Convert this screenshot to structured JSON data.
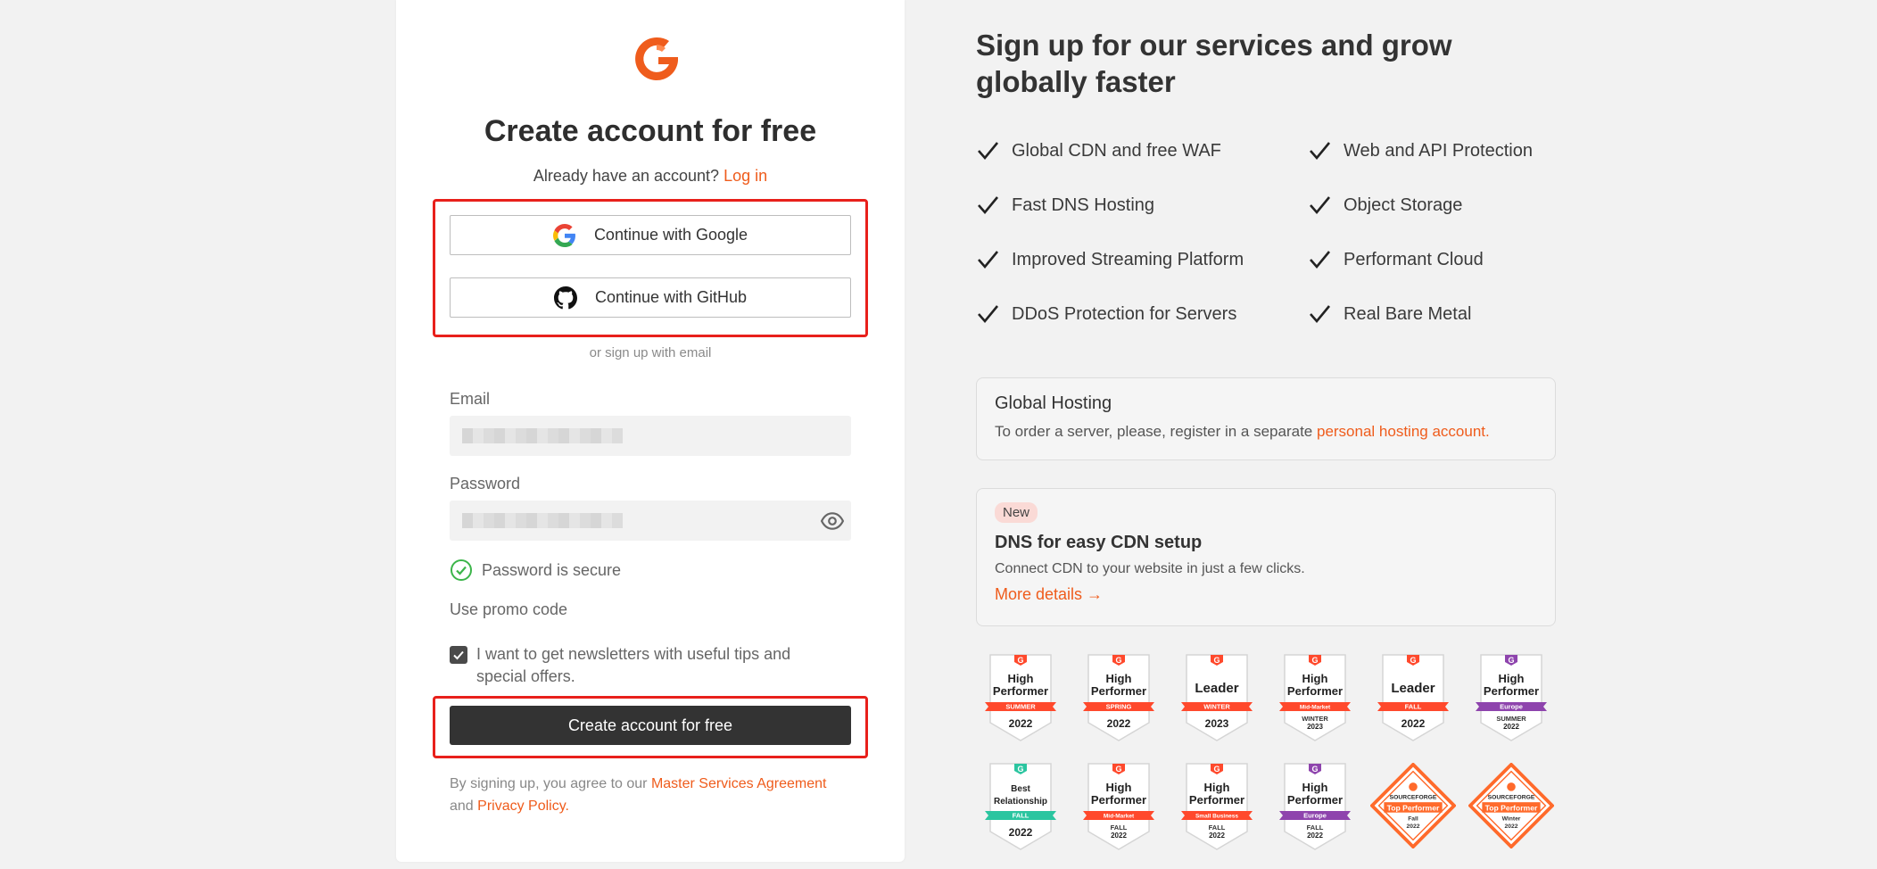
{
  "signup": {
    "title": "Create account for free",
    "have_account_text": "Already have an account?",
    "login_link": "Log in",
    "google_button": "Continue with Google",
    "github_button": "Continue with GitHub",
    "or_email": "or sign up with email",
    "email_label": "Email",
    "password_label": "Password",
    "password_status": "Password is secure",
    "promo_code": "Use promo code",
    "newsletter_label": "I want to get newsletters with useful tips and special offers.",
    "newsletter_checked": true,
    "create_button": "Create account for free",
    "terms_prefix": "By signing up, you agree to our",
    "terms_link": "Master Services Agreement",
    "terms_and": "and",
    "privacy_link": "Privacy Policy."
  },
  "promo": {
    "title": "Sign up for our services and grow globally faster",
    "features_left": [
      "Global CDN and free WAF",
      "Fast DNS Hosting",
      "Improved Streaming Platform",
      "DDoS Protection for Servers"
    ],
    "features_right": [
      "Web and API Protection",
      "Object Storage",
      "Performant Cloud",
      "Real Bare Metal"
    ],
    "hosting": {
      "title": "Global Hosting",
      "text": "To order a server, please, register in a separate",
      "link": "personal hosting account."
    },
    "dns": {
      "tag": "New",
      "title": "DNS for easy CDN setup",
      "text": "Connect CDN to your website in just a few clicks.",
      "link": "More details →"
    },
    "badges_row1": [
      {
        "line1": "High",
        "line2": "Performer",
        "ribbon": "SUMMER",
        "season": "",
        "year": "2022",
        "color": "#ff492c"
      },
      {
        "line1": "High",
        "line2": "Performer",
        "ribbon": "SPRING",
        "season": "",
        "year": "2022",
        "color": "#ff492c"
      },
      {
        "line1": "Leader",
        "line2": "",
        "ribbon": "WINTER",
        "season": "",
        "year": "2023",
        "color": "#ff492c"
      },
      {
        "line1": "High",
        "line2": "Performer",
        "ribbon": "Mid-Market",
        "season": "WINTER",
        "year": "2023",
        "color": "#ff492c"
      },
      {
        "line1": "Leader",
        "line2": "",
        "ribbon": "FALL",
        "season": "",
        "year": "2022",
        "color": "#ff492c"
      },
      {
        "line1": "High",
        "line2": "Performer",
        "ribbon": "Europe",
        "season": "SUMMER",
        "year": "2022",
        "color": "#8e44ad"
      }
    ],
    "badges_row2": [
      {
        "line1": "Best",
        "line2": "Relationship",
        "ribbon": "FALL",
        "season": "",
        "year": "2022",
        "color": "#2bc5a0"
      },
      {
        "line1": "High",
        "line2": "Performer",
        "ribbon": "Mid-Market",
        "season": "FALL",
        "year": "2022",
        "color": "#ff492c"
      },
      {
        "line1": "High",
        "line2": "Performer",
        "ribbon": "Small Business",
        "season": "FALL",
        "year": "2022",
        "color": "#ff492c"
      },
      {
        "line1": "High",
        "line2": "Performer",
        "ribbon": "Europe",
        "season": "FALL",
        "year": "2022",
        "color": "#8e44ad"
      }
    ],
    "sourceforge_badges": [
      {
        "brand": "SOURCEFORGE",
        "label": "Top Performer",
        "season": "Fall",
        "year": "2022"
      },
      {
        "brand": "SOURCEFORGE",
        "label": "Top Performer",
        "season": "Winter",
        "year": "2022"
      }
    ]
  },
  "colors": {
    "accent": "#ef5c1c",
    "highlight": "#e8201b",
    "dark_button": "#333333",
    "success": "#3cb54a"
  }
}
